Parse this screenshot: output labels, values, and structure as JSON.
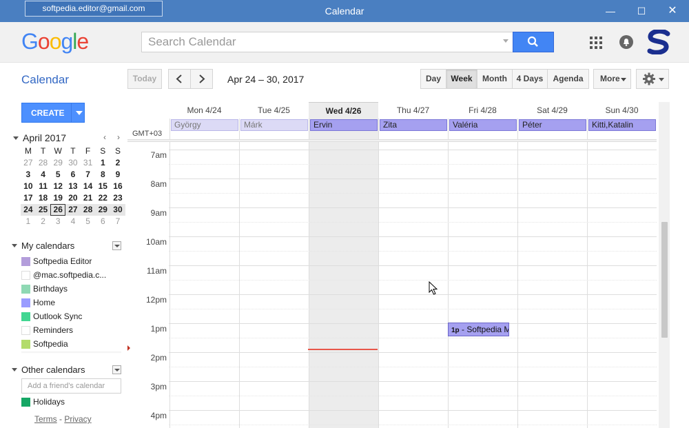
{
  "window": {
    "account": "softpedia.editor@gmail.com",
    "title": "Calendar"
  },
  "header": {
    "logo": "Google",
    "search_placeholder": "Search Calendar"
  },
  "toolbar": {
    "app_title": "Calendar",
    "today": "Today",
    "date_range": "Apr 24 – 30, 2017",
    "views": [
      "Day",
      "Week",
      "Month",
      "4 Days",
      "Agenda"
    ],
    "selected_view": "Week",
    "more": "More"
  },
  "sidebar": {
    "create": "CREATE",
    "mini_month": "April 2017",
    "weekdays": [
      "M",
      "T",
      "W",
      "T",
      "F",
      "S",
      "S"
    ],
    "weeks": [
      [
        "27",
        "28",
        "29",
        "30",
        "31",
        "1",
        "2"
      ],
      [
        "3",
        "4",
        "5",
        "6",
        "7",
        "8",
        "9"
      ],
      [
        "10",
        "11",
        "12",
        "13",
        "14",
        "15",
        "16"
      ],
      [
        "17",
        "18",
        "19",
        "20",
        "21",
        "22",
        "23"
      ],
      [
        "24",
        "25",
        "26",
        "27",
        "28",
        "29",
        "30"
      ],
      [
        "1",
        "2",
        "3",
        "4",
        "5",
        "6",
        "7"
      ]
    ],
    "my_calendars_title": "My calendars",
    "my_calendars": [
      {
        "label": "Softpedia Editor",
        "color": "#b39ddb"
      },
      {
        "label": "@mac.softpedia.c...",
        "color": "#ffffff"
      },
      {
        "label": "Birthdays",
        "color": "#8fd9b4"
      },
      {
        "label": "Home",
        "color": "#9a9cff"
      },
      {
        "label": "Outlook Sync",
        "color": "#42d692"
      },
      {
        "label": "Reminders",
        "color": "#ffffff"
      },
      {
        "label": "Softpedia",
        "color": "#b3dc6c"
      }
    ],
    "other_calendars_title": "Other calendars",
    "friend_placeholder": "Add a friend's calendar",
    "other_calendars": [
      {
        "label": "Holidays",
        "color": "#16a765"
      }
    ],
    "terms": "Terms",
    "privacy": "Privacy"
  },
  "week": {
    "days": [
      "Mon 4/24",
      "Tue 4/25",
      "Wed 4/26",
      "Thu 4/27",
      "Fri 4/28",
      "Sat 4/29",
      "Sun 4/30"
    ],
    "today_index": 2,
    "allday": [
      "György",
      "Márk",
      "Ervin",
      "Zita",
      "Valéria",
      "Péter",
      "Kitti,Katalin"
    ],
    "timezone": "GMT+03",
    "hours": [
      "7am",
      "8am",
      "9am",
      "10am",
      "11am",
      "12pm",
      "1pm",
      "2pm",
      "3pm",
      "4pm"
    ],
    "event": {
      "time": "1p",
      "title": " - Softpedia M"
    }
  }
}
